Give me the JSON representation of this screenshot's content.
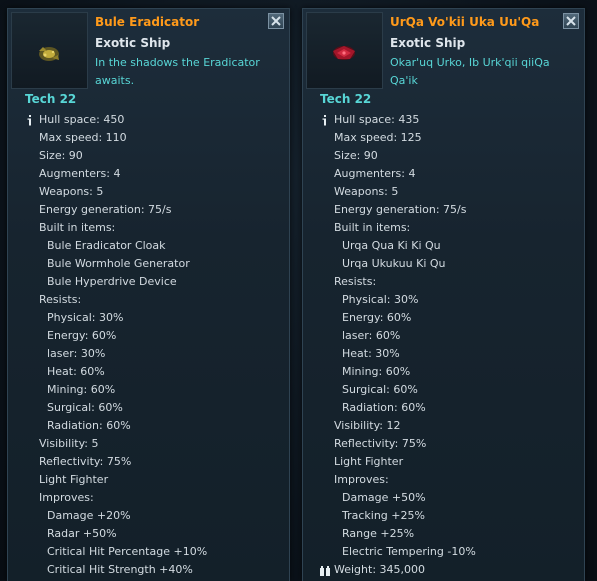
{
  "panels": [
    {
      "title": "Bule Eradicator",
      "subtitle": "Exotic Ship",
      "description": "In the shadows the Eradicator awaits.",
      "tech": "Tech 22",
      "thumb_color": "#b8a33a",
      "rows": [
        {
          "text": "Hull space: 450",
          "level": 1,
          "icon": "info-icon"
        },
        {
          "text": "Max speed: 110",
          "level": 1
        },
        {
          "text": "Size: 90",
          "level": 1
        },
        {
          "text": "Augmenters: 4",
          "level": 1
        },
        {
          "text": "Weapons: 5",
          "level": 1
        },
        {
          "text": "Energy generation: 75/s",
          "level": 1
        },
        {
          "text": "Built in items:",
          "level": 1
        },
        {
          "text": "Bule Eradicator Cloak",
          "level": 2
        },
        {
          "text": "Bule Wormhole Generator",
          "level": 2
        },
        {
          "text": "Bule Hyperdrive Device",
          "level": 2
        },
        {
          "text": "Resists:",
          "level": 1
        },
        {
          "text": "Physical: 30%",
          "level": 2
        },
        {
          "text": "Energy: 60%",
          "level": 2
        },
        {
          "text": "laser: 30%",
          "level": 2
        },
        {
          "text": "Heat: 60%",
          "level": 2
        },
        {
          "text": "Mining: 60%",
          "level": 2
        },
        {
          "text": "Surgical: 60%",
          "level": 2
        },
        {
          "text": "Radiation: 60%",
          "level": 2
        },
        {
          "text": "Visibility: 5",
          "level": 1
        },
        {
          "text": "Reflectivity: 75%",
          "level": 1
        },
        {
          "text": "Light Fighter",
          "level": 1
        },
        {
          "text": "Improves:",
          "level": 1
        },
        {
          "text": "Damage +20%",
          "level": 2
        },
        {
          "text": "Radar +50%",
          "level": 2
        },
        {
          "text": "Critical Hit Percentage +10%",
          "level": 2
        },
        {
          "text": "Critical Hit Strength +40%",
          "level": 2
        }
      ]
    },
    {
      "title": "UrQa Vo'kii Uka Uu'Qa",
      "subtitle": "Exotic Ship",
      "description": "Okar'uq Urko, Ib Urk'qii qiiQa Qa'ik",
      "tech": "Tech 22",
      "thumb_color": "#b0182a",
      "rows": [
        {
          "text": "Hull space: 435",
          "level": 1,
          "icon": "info-icon"
        },
        {
          "text": "Max speed: 125",
          "level": 1
        },
        {
          "text": "Size: 90",
          "level": 1
        },
        {
          "text": "Augmenters: 4",
          "level": 1
        },
        {
          "text": "Weapons: 5",
          "level": 1
        },
        {
          "text": "Energy generation: 75/s",
          "level": 1
        },
        {
          "text": "Built in items:",
          "level": 1
        },
        {
          "text": "Urqa Qua Ki Ki Qu",
          "level": 2
        },
        {
          "text": "Urqa Ukukuu Ki Qu",
          "level": 2
        },
        {
          "text": "Resists:",
          "level": 1
        },
        {
          "text": "Physical: 30%",
          "level": 2
        },
        {
          "text": "Energy: 60%",
          "level": 2
        },
        {
          "text": "laser: 60%",
          "level": 2
        },
        {
          "text": "Heat: 30%",
          "level": 2
        },
        {
          "text": "Mining: 60%",
          "level": 2
        },
        {
          "text": "Surgical: 60%",
          "level": 2
        },
        {
          "text": "Radiation: 60%",
          "level": 2
        },
        {
          "text": "Visibility: 12",
          "level": 1
        },
        {
          "text": "Reflectivity: 75%",
          "level": 1
        },
        {
          "text": "Light Fighter",
          "level": 1
        },
        {
          "text": "Improves:",
          "level": 1
        },
        {
          "text": "Damage +50%",
          "level": 2
        },
        {
          "text": "Tracking +25%",
          "level": 2
        },
        {
          "text": "Range +25%",
          "level": 2
        },
        {
          "text": "Electric Tempering -10%",
          "level": 2
        },
        {
          "text": "Weight: 345,000",
          "level": 1,
          "icon": "weight-icon"
        }
      ]
    }
  ]
}
